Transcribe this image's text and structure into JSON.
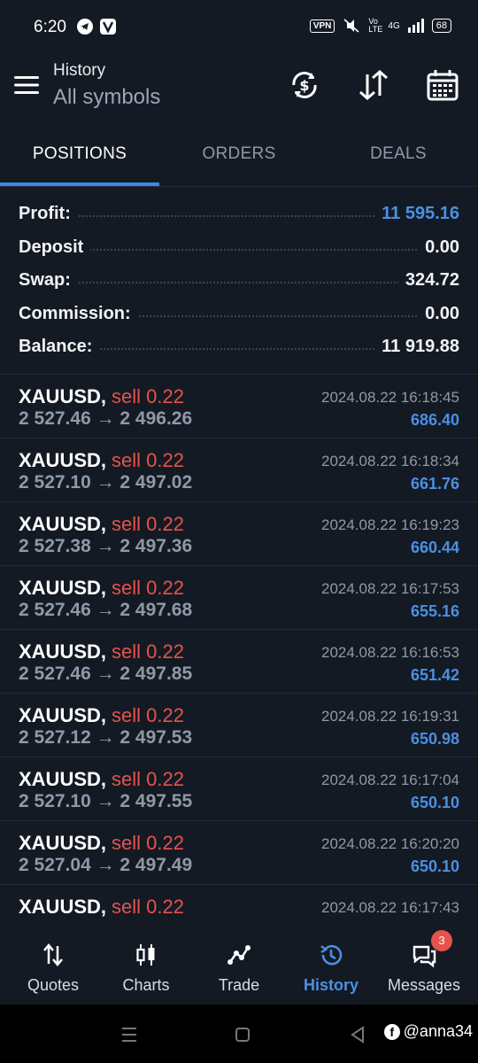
{
  "status_bar": {
    "time": "6:20",
    "vpn": "VPN",
    "volte": "Vo LTE",
    "network": "4G",
    "battery": "68"
  },
  "app_bar": {
    "title": "History",
    "subtitle": "All symbols"
  },
  "tabs": [
    {
      "label": "POSITIONS",
      "active": true
    },
    {
      "label": "ORDERS",
      "active": false
    },
    {
      "label": "DEALS",
      "active": false
    }
  ],
  "summary": [
    {
      "label": "Profit:",
      "value": "11 595.16",
      "highlight": true
    },
    {
      "label": "Deposit",
      "value": "0.00",
      "highlight": false
    },
    {
      "label": "Swap:",
      "value": "324.72",
      "highlight": false
    },
    {
      "label": "Commission:",
      "value": "0.00",
      "highlight": false
    },
    {
      "label": "Balance:",
      "value": "11 919.88",
      "highlight": false
    }
  ],
  "deals": [
    {
      "symbol": "XAUUSD,",
      "side": "sell 0.22",
      "prices": "2 527.46 → 2 496.26",
      "time": "2024.08.22 16:18:45",
      "profit": "686.40"
    },
    {
      "symbol": "XAUUSD,",
      "side": "sell 0.22",
      "prices": "2 527.10 → 2 497.02",
      "time": "2024.08.22 16:18:34",
      "profit": "661.76"
    },
    {
      "symbol": "XAUUSD,",
      "side": "sell 0.22",
      "prices": "2 527.38 → 2 497.36",
      "time": "2024.08.22 16:19:23",
      "profit": "660.44"
    },
    {
      "symbol": "XAUUSD,",
      "side": "sell 0.22",
      "prices": "2 527.46 → 2 497.68",
      "time": "2024.08.22 16:17:53",
      "profit": "655.16"
    },
    {
      "symbol": "XAUUSD,",
      "side": "sell 0.22",
      "prices": "2 527.46 → 2 497.85",
      "time": "2024.08.22 16:16:53",
      "profit": "651.42"
    },
    {
      "symbol": "XAUUSD,",
      "side": "sell 0.22",
      "prices": "2 527.12 → 2 497.53",
      "time": "2024.08.22 16:19:31",
      "profit": "650.98"
    },
    {
      "symbol": "XAUUSD,",
      "side": "sell 0.22",
      "prices": "2 527.10 → 2 497.55",
      "time": "2024.08.22 16:17:04",
      "profit": "650.10"
    },
    {
      "symbol": "XAUUSD,",
      "side": "sell 0.22",
      "prices": "2 527.04 → 2 497.49",
      "time": "2024.08.22 16:20:20",
      "profit": "650.10"
    },
    {
      "symbol": "XAUUSD,",
      "side": "sell 0.22",
      "prices": "",
      "time": "2024.08.22 16:17:43",
      "profit": ""
    }
  ],
  "bottom_nav": [
    {
      "label": "Quotes",
      "icon": "arrows-updown-icon",
      "active": false
    },
    {
      "label": "Charts",
      "icon": "candlestick-icon",
      "active": false
    },
    {
      "label": "Trade",
      "icon": "trend-line-icon",
      "active": false
    },
    {
      "label": "History",
      "icon": "history-clock-icon",
      "active": true
    },
    {
      "label": "Messages",
      "icon": "chat-icon",
      "active": false,
      "badge": "3"
    }
  ],
  "watermark": "@anna34",
  "colors": {
    "background": "#141a24",
    "accent_blue": "#4a90e2",
    "sell_red": "#e5534b",
    "muted_gray": "#8e99a8"
  }
}
